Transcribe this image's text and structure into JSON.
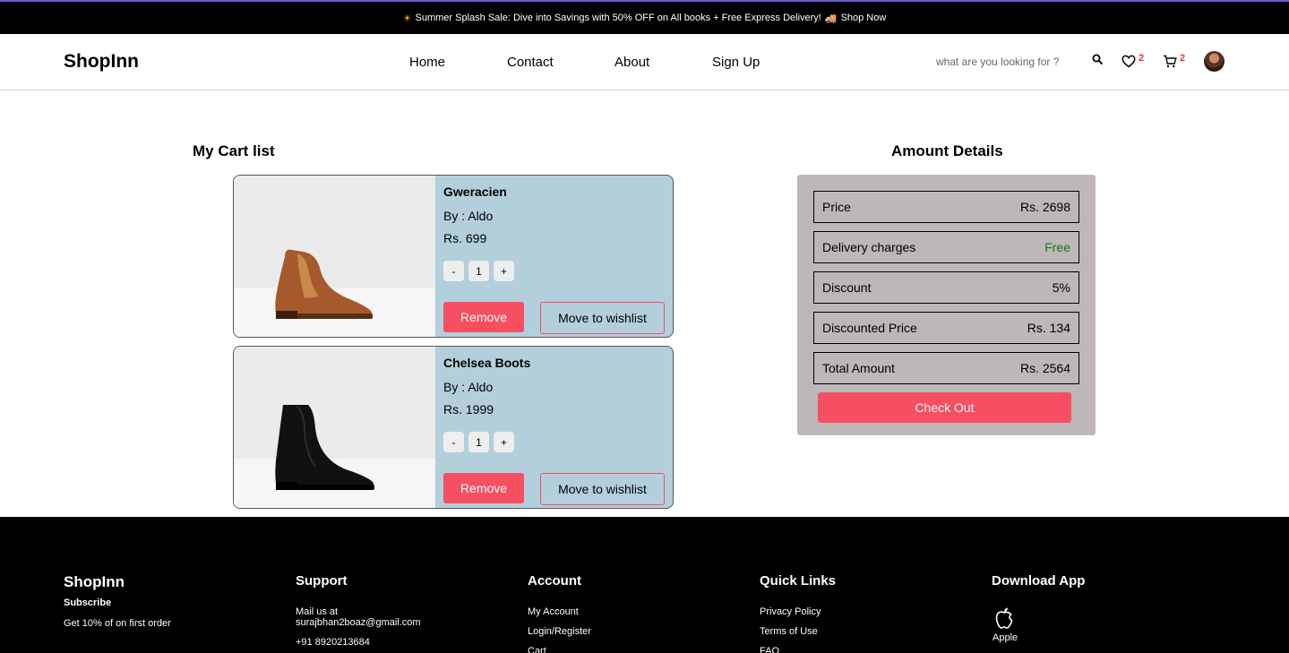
{
  "promo": {
    "text": "Summer Splash Sale: Dive into Savings with 50% OFF on All books + Free Express Delivery!",
    "link": "Shop Now"
  },
  "header": {
    "brand": "ShopInn",
    "nav": [
      "Home",
      "Contact",
      "About",
      "Sign Up"
    ],
    "search_placeholder": "what are you looking for ?",
    "wishlist_count": "2",
    "cart_count": "2"
  },
  "cart": {
    "title": "My Cart list",
    "items": [
      {
        "name": "Gweracien",
        "brand": "By : Aldo",
        "price": "Rs. 699",
        "qty": "1",
        "color": "#a65a2b"
      },
      {
        "name": "Chelsea Boots",
        "brand": "By : Aldo",
        "price": "Rs. 1999",
        "qty": "1",
        "color": "#111111"
      }
    ],
    "minus_label": "-",
    "plus_label": "+",
    "remove_label": "Remove",
    "wishlist_label": "Move to wishlist"
  },
  "summary": {
    "title": "Amount Details",
    "rows": [
      {
        "label": "Price",
        "value": "Rs. 2698"
      },
      {
        "label": "Delivery charges",
        "value": "Free"
      },
      {
        "label": "Discount",
        "value": "5%"
      },
      {
        "label": "Discounted Price",
        "value": "Rs. 134"
      },
      {
        "label": "Total Amount",
        "value": "Rs. 2564"
      }
    ],
    "checkout_label": "Check Out"
  },
  "footer": {
    "brand": "ShopInn",
    "subscribe": "Subscribe",
    "offer": "Get 10% of on first order",
    "support": {
      "title": "Support",
      "mail_label": "Mail us at",
      "mail": "surajbhan2boaz@gmail.com",
      "phone": "+91 8920213684"
    },
    "account": {
      "title": "Account",
      "items": [
        "My Account",
        "Login/Register",
        "Cart"
      ]
    },
    "quick": {
      "title": "Quick Links",
      "items": [
        "Privacy Policy",
        "Terms of Use",
        "FAQ"
      ]
    },
    "download": {
      "title": "Download App",
      "apple": "Apple"
    }
  },
  "colors": {
    "accent": "#f74f62",
    "card_bg": "#b3cfdc",
    "summary_bg": "#bdb7b7",
    "free": "#137a13"
  }
}
